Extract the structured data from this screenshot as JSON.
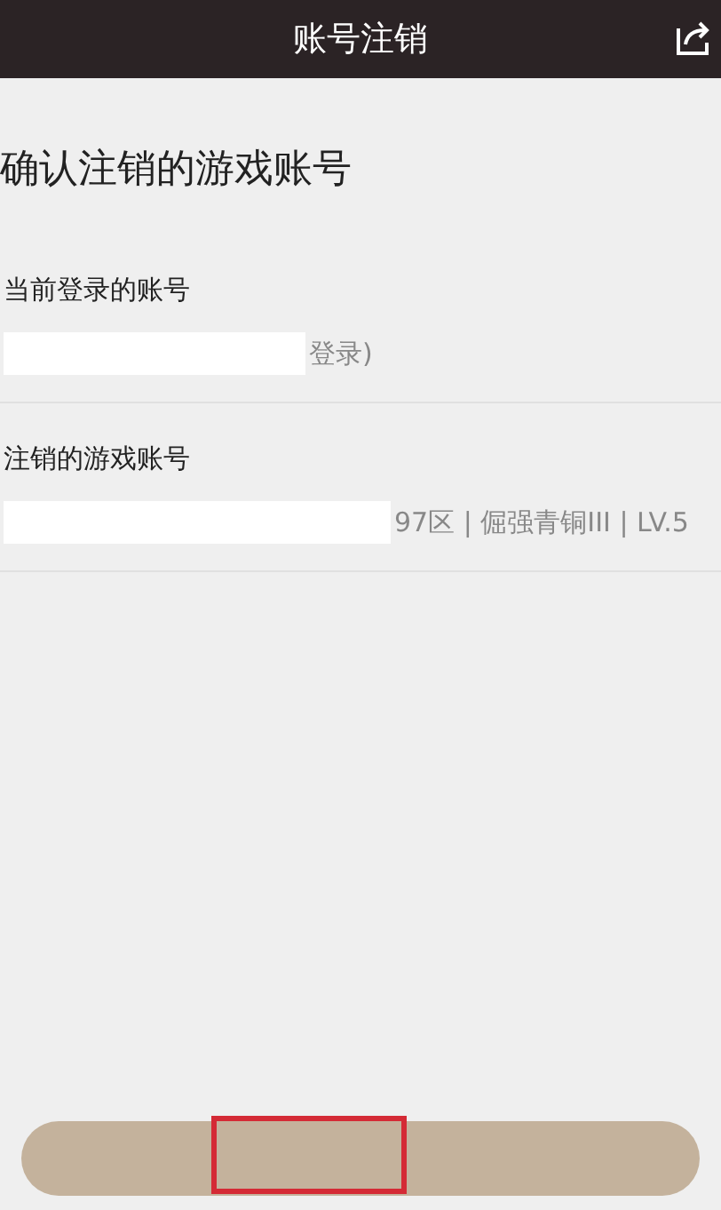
{
  "header": {
    "title": "账号注销"
  },
  "heading": "确认注销的游戏账号",
  "sections": [
    {
      "label": "当前登录的账号",
      "value": "登录)"
    },
    {
      "label": "注销的游戏账号",
      "value": "97区 | 倔强青铜III | LV.5"
    }
  ],
  "bottom_button": {
    "highlighted": true
  }
}
